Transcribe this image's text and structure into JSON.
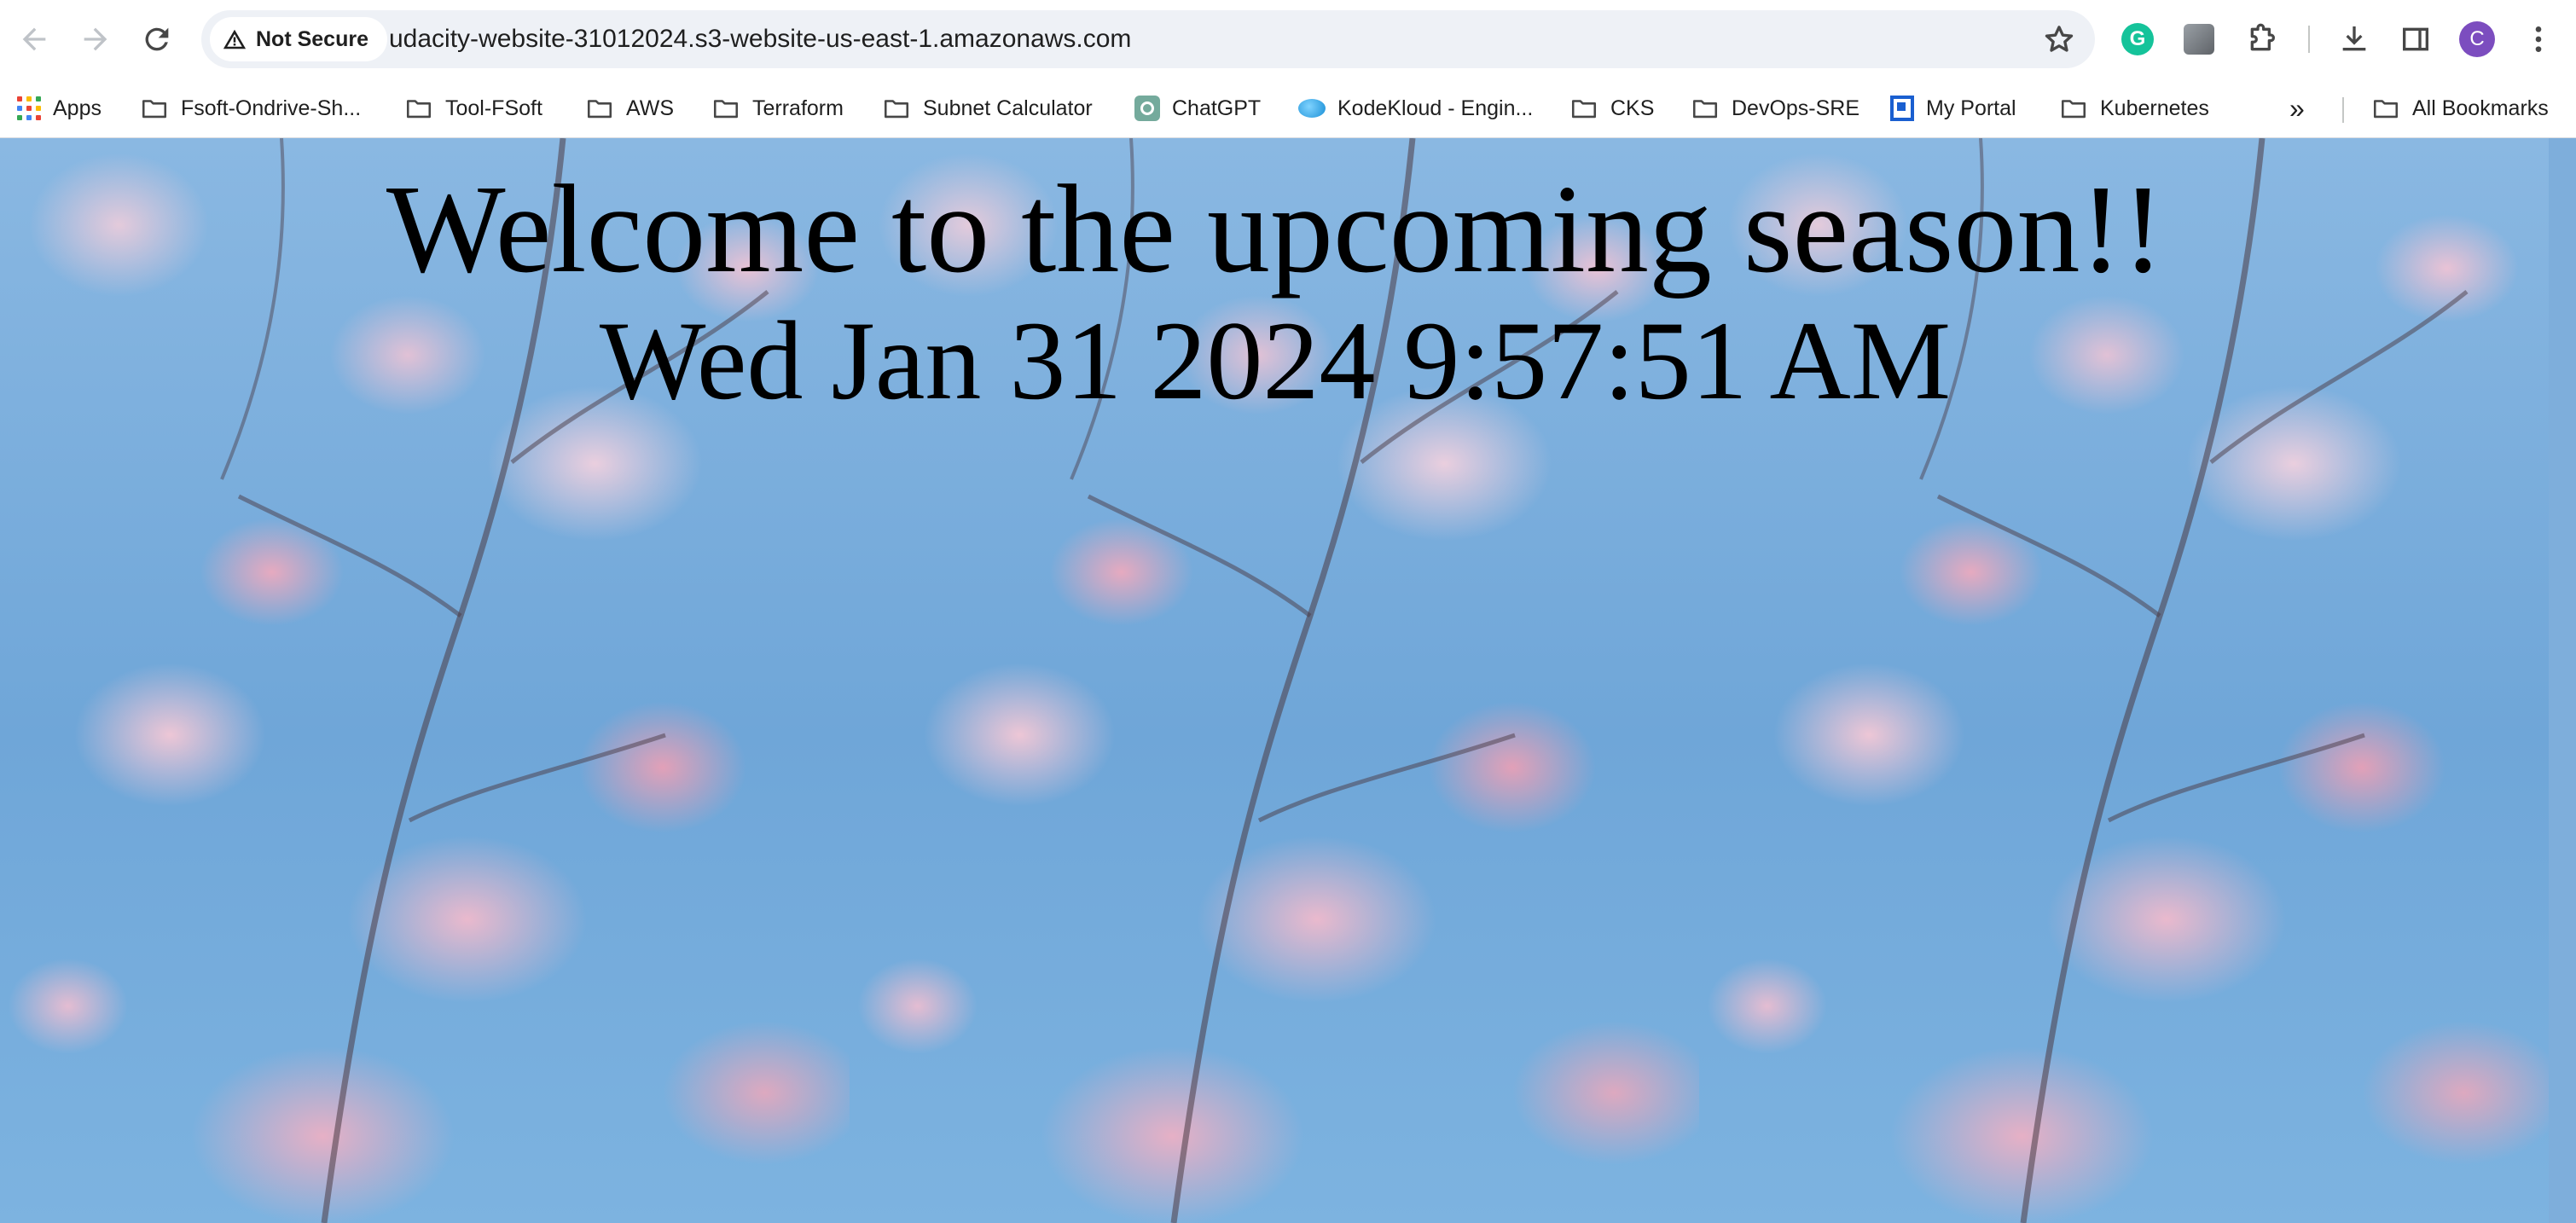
{
  "browser": {
    "security_label": "Not Secure",
    "url": "udacity-website-31012024.s3-website-us-east-1.amazonaws.com",
    "avatar_initial": "C",
    "icons": [
      "back-icon",
      "forward-icon",
      "reload-icon",
      "warning-icon",
      "star-icon",
      "grammarly-extension-icon",
      "extension-icon",
      "extensions-puzzle-icon",
      "download-icon",
      "side-panel-icon",
      "more-icon"
    ]
  },
  "bookmarks": {
    "items": [
      {
        "label": "Apps",
        "icon": "apps-icon"
      },
      {
        "label": "Fsoft-Ondrive-Sh...",
        "icon": "folder-icon"
      },
      {
        "label": "Tool-FSoft",
        "icon": "folder-icon"
      },
      {
        "label": "AWS",
        "icon": "folder-icon"
      },
      {
        "label": "Terraform",
        "icon": "folder-icon"
      },
      {
        "label": "Subnet Calculator",
        "icon": "folder-icon"
      },
      {
        "label": "ChatGPT",
        "icon": "chatgpt-icon"
      },
      {
        "label": "KodeKloud - Engin...",
        "icon": "kodekloud-icon"
      },
      {
        "label": "CKS",
        "icon": "folder-icon"
      },
      {
        "label": "DevOps-SRE",
        "icon": "folder-icon"
      },
      {
        "label": "My Portal",
        "icon": "portal-icon"
      },
      {
        "label": "Kubernetes",
        "icon": "folder-icon"
      }
    ],
    "overflow_label": "»",
    "all_bookmarks_label": "All Bookmarks"
  },
  "page": {
    "heading": "Welcome to the upcoming season!!",
    "datetime": "Wed Jan 31 2024 9:57:51 AM",
    "background": "cherry-blossom-image"
  },
  "colors": {
    "sky": "#7eaedb",
    "blossom": "#f0bcd0",
    "omnibox": "#eef1f6",
    "avatar": "#7c4dbf",
    "grammarly": "#15c39a"
  }
}
